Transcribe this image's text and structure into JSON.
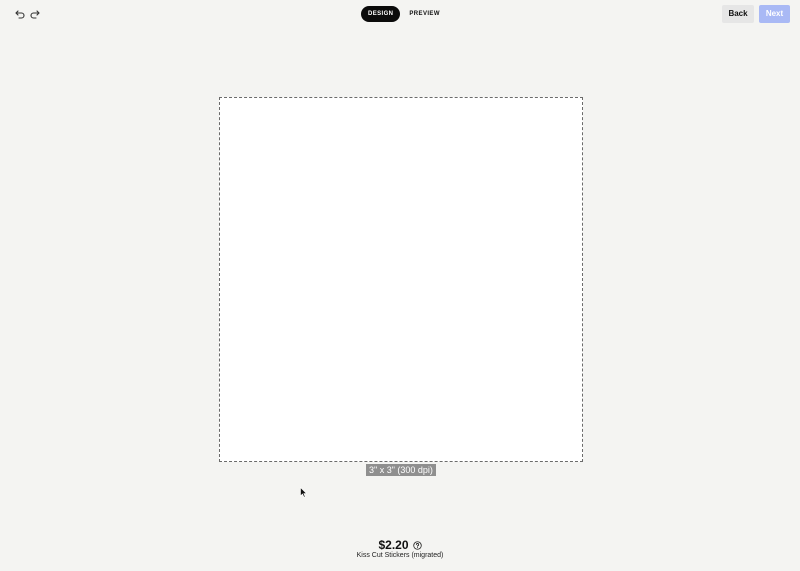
{
  "toolbar": {
    "undo_icon": "undo-icon",
    "redo_icon": "redo-icon",
    "modes": [
      {
        "label": "DESIGN",
        "active": true
      },
      {
        "label": "PREVIEW",
        "active": false
      }
    ],
    "back_label": "Back",
    "next_label": "Next"
  },
  "canvas": {
    "dimension_label": "3\" x 3\" (300 dpi)"
  },
  "footer": {
    "price": "$2.20",
    "product_name": "Kiss Cut Stickers (migrated)"
  },
  "colors": {
    "background": "#f4f4f2",
    "active_tab": "#0b0b0b",
    "next_button": "#a9b9f5",
    "back_button": "#e6e6e6"
  }
}
